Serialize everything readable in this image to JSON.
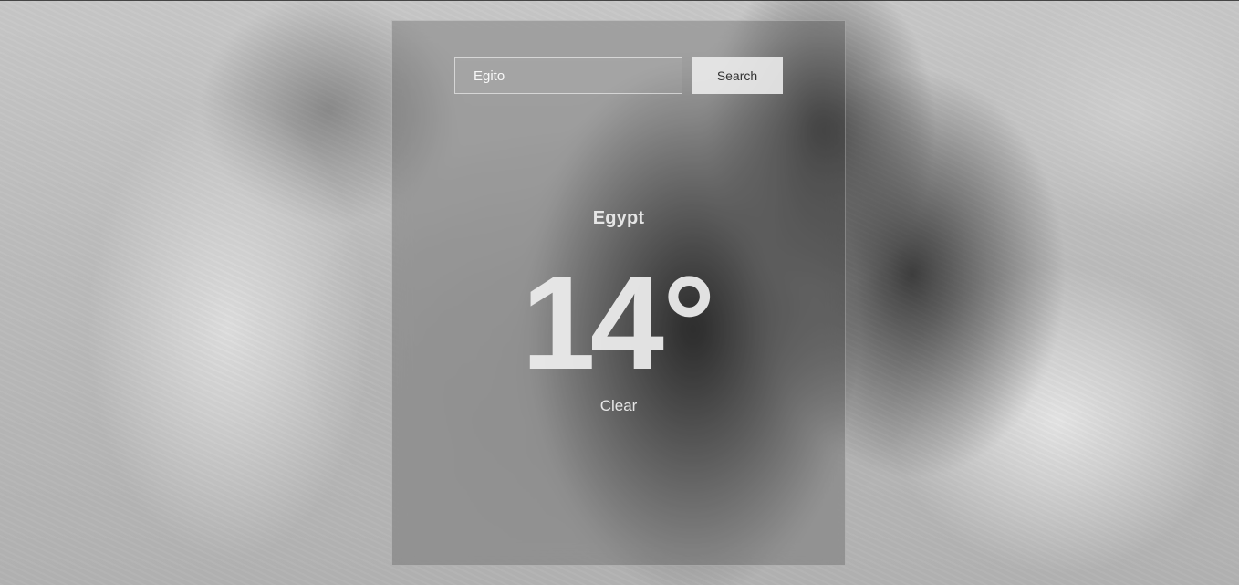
{
  "search": {
    "value": "Egito",
    "placeholder": "",
    "button_label": "Search"
  },
  "weather": {
    "city": "Egypt",
    "temperature": "14",
    "degree_symbol": "°",
    "condition": "Clear"
  }
}
